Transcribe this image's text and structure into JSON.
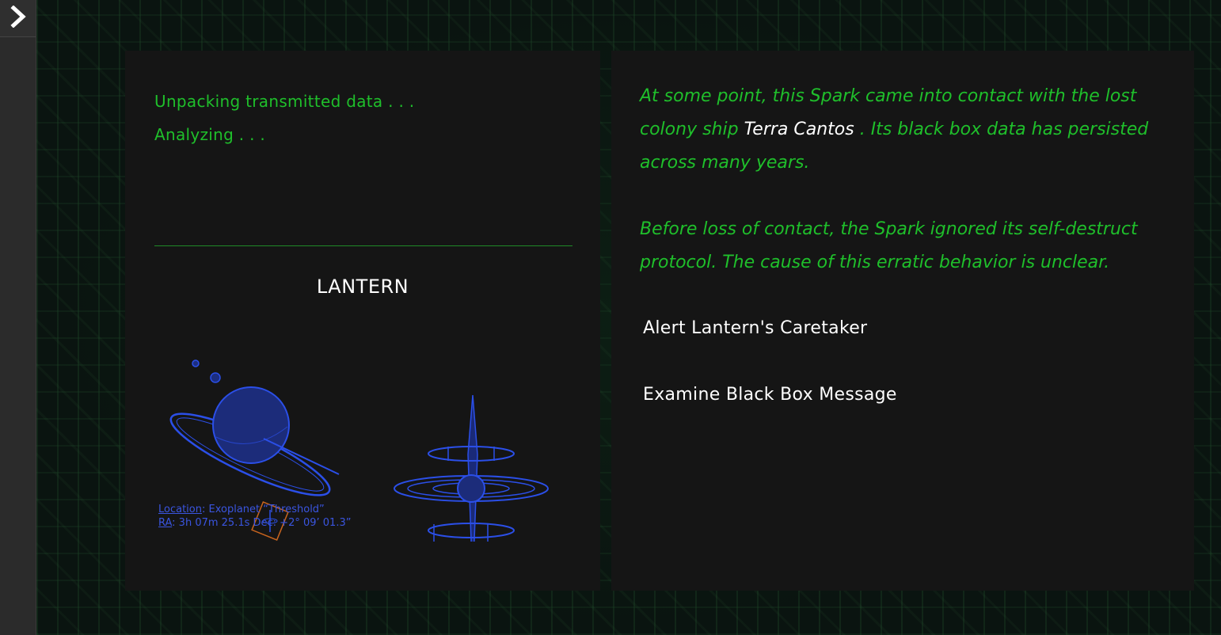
{
  "sidebar": {
    "toggle_icon": "chevron-right-icon"
  },
  "left_panel": {
    "status_lines": [
      "Unpacking transmitted data . . .",
      "Analyzing . . ."
    ],
    "spark_name": "LANTERN",
    "location": {
      "location_label": "Location",
      "location_value": ": Exoplanet “Threshold”",
      "ra_label": "RA",
      "ra_value": ": 3h 07m 25.1s Dec: +2° 09’ 01.3”"
    }
  },
  "right_panel": {
    "paragraph1_before": "At some point, this Spark came into contact with the lost colony ship ",
    "paragraph1_highlight": "Terra Cantos",
    "paragraph1_after": " . Its black box data has persisted across many years.",
    "paragraph2": "Before loss of contact, the Spark ignored its self-destruct protocol. The cause of this erratic behavior is unclear.",
    "choices": [
      "Alert Lantern's Caretaker",
      "Examine Black Box Message"
    ]
  },
  "colors": {
    "terminal_green": "#1fbf2b",
    "panel_bg": "#151515",
    "illustration_blue": "#2b4fe8",
    "marker_orange": "#c8641e"
  }
}
